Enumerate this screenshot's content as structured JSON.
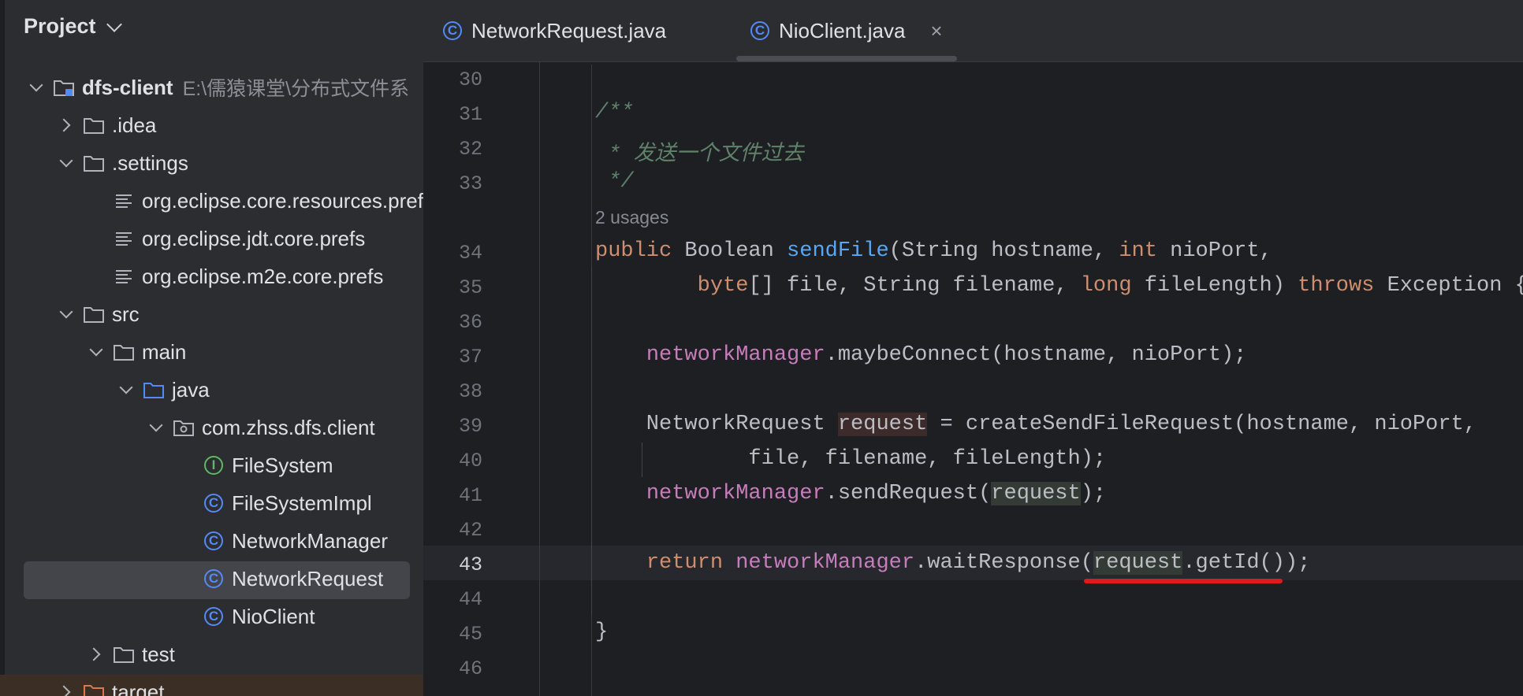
{
  "sidebar": {
    "title": "Project",
    "tree": [
      {
        "label": "dfs-client",
        "hint": "E:\\儒猿课堂\\分布式文件系",
        "arrow": "down",
        "icon": "module-folder-icon",
        "depth": 0
      },
      {
        "label": ".idea",
        "arrow": "right",
        "icon": "folder-icon",
        "depth": 1
      },
      {
        "label": ".settings",
        "arrow": "down",
        "icon": "folder-icon",
        "depth": 1
      },
      {
        "label": "org.eclipse.core.resources.prefs",
        "arrow": "none",
        "icon": "text-file-icon",
        "depth": 2
      },
      {
        "label": "org.eclipse.jdt.core.prefs",
        "arrow": "none",
        "icon": "text-file-icon",
        "depth": 2
      },
      {
        "label": "org.eclipse.m2e.core.prefs",
        "arrow": "none",
        "icon": "text-file-icon",
        "depth": 2
      },
      {
        "label": "src",
        "arrow": "down",
        "icon": "folder-icon",
        "depth": 1
      },
      {
        "label": "main",
        "arrow": "down",
        "icon": "folder-icon",
        "depth": 2
      },
      {
        "label": "java",
        "arrow": "down",
        "icon": "source-folder-icon",
        "depth": 3
      },
      {
        "label": "com.zhss.dfs.client",
        "arrow": "down",
        "icon": "package-icon",
        "depth": 4
      },
      {
        "label": "FileSystem",
        "arrow": "none",
        "icon": "interface-icon",
        "depth": 5
      },
      {
        "label": "FileSystemImpl",
        "arrow": "none",
        "icon": "class-icon",
        "depth": 5
      },
      {
        "label": "NetworkManager",
        "arrow": "none",
        "icon": "class-icon",
        "depth": 5
      },
      {
        "label": "NetworkRequest",
        "arrow": "none",
        "icon": "class-icon",
        "depth": 5,
        "selected": true
      },
      {
        "label": "NioClient",
        "arrow": "none",
        "icon": "class-icon",
        "depth": 5
      },
      {
        "label": "test",
        "arrow": "right",
        "icon": "folder-icon",
        "depth": 2
      },
      {
        "label": "target",
        "arrow": "right",
        "icon": "excluded-folder-icon",
        "depth": 1
      }
    ]
  },
  "tabs": [
    {
      "label": "NetworkRequest.java",
      "icon": "class-icon",
      "active": false
    },
    {
      "label": "NioClient.java",
      "icon": "class-icon",
      "active": true,
      "close": "×"
    }
  ],
  "editor": {
    "usages": "2 usages",
    "current_line": "43",
    "lines": [
      {
        "num": "30",
        "parts": []
      },
      {
        "num": "31",
        "parts": [
          {
            "t": "/**",
            "c": "cmt"
          }
        ]
      },
      {
        "num": "32",
        "parts": [
          {
            "t": " * 发送一个文件过去",
            "c": "cmt"
          }
        ]
      },
      {
        "num": "33",
        "parts": [
          {
            "t": " */",
            "c": "cmt"
          }
        ]
      },
      {
        "num": "34",
        "parts": [
          {
            "t": "public",
            "c": "kw"
          },
          {
            "t": " Boolean ",
            "c": ""
          },
          {
            "t": "sendFile",
            "c": "mth"
          },
          {
            "t": "(String hostname, ",
            "c": ""
          },
          {
            "t": "int",
            "c": "kw"
          },
          {
            "t": " nioPort,",
            "c": ""
          }
        ]
      },
      {
        "num": "35",
        "parts": [
          {
            "t": "        ",
            "c": ""
          },
          {
            "t": "byte",
            "c": "kw"
          },
          {
            "t": "[] file, String filename, ",
            "c": ""
          },
          {
            "t": "long",
            "c": "kw"
          },
          {
            "t": " fileLength) ",
            "c": ""
          },
          {
            "t": "throws",
            "c": "kw"
          },
          {
            "t": " Exception {",
            "c": ""
          }
        ]
      },
      {
        "num": "36",
        "parts": []
      },
      {
        "num": "37",
        "parts": [
          {
            "t": "    ",
            "c": ""
          },
          {
            "t": "networkManager",
            "c": "fld"
          },
          {
            "t": ".maybeConnect(hostname, nioPort);",
            "c": ""
          }
        ]
      },
      {
        "num": "38",
        "parts": []
      },
      {
        "num": "39",
        "parts": [
          {
            "t": "    NetworkRequest ",
            "c": ""
          },
          {
            "t": "request",
            "c": "hl-var"
          },
          {
            "t": " = createSendFileRequest(hostname, nioPort,",
            "c": ""
          }
        ]
      },
      {
        "num": "40",
        "parts": [
          {
            "t": "            file, filename, fileLength);",
            "c": ""
          }
        ]
      },
      {
        "num": "41",
        "parts": [
          {
            "t": "    ",
            "c": ""
          },
          {
            "t": "networkManager",
            "c": "fld"
          },
          {
            "t": ".sendRequest(",
            "c": ""
          },
          {
            "t": "request",
            "c": "hl-var2"
          },
          {
            "t": ");",
            "c": ""
          }
        ]
      },
      {
        "num": "42",
        "parts": []
      },
      {
        "num": "43",
        "parts": [
          {
            "t": "    ",
            "c": ""
          },
          {
            "t": "return",
            "c": "kw"
          },
          {
            "t": " ",
            "c": ""
          },
          {
            "t": "networkManager",
            "c": "fld"
          },
          {
            "t": ".waitResponse(",
            "c": ""
          },
          {
            "t": "request",
            "c": "hl-var2"
          },
          {
            "t": ".getId());",
            "c": ""
          }
        ]
      },
      {
        "num": "44",
        "parts": []
      },
      {
        "num": "45",
        "parts": [
          {
            "t": "}",
            "c": ""
          }
        ]
      },
      {
        "num": "46",
        "parts": []
      }
    ]
  },
  "colors": {
    "keyword": "#cf8e6d",
    "field": "#c77dbb",
    "method": "#56a8f5",
    "comment": "#5f826b",
    "error_underline": "#e0191e"
  }
}
